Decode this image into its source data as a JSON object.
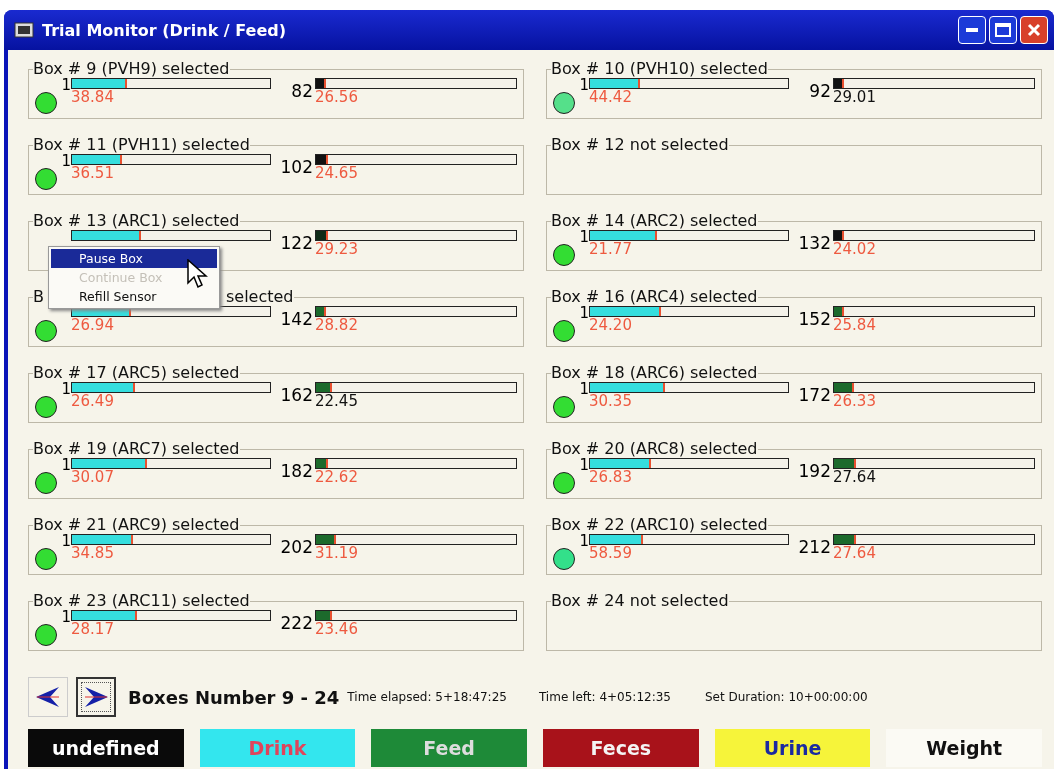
{
  "window": {
    "title": "Trial Monitor (Drink / Feed)"
  },
  "boxes": [
    {
      "title_parts": [
        "Box # 9 (PVH9) selected"
      ],
      "selected": true,
      "color": "#33dd33",
      "left_number": "1",
      "drink": {
        "level": 0.28,
        "reading": "38.84",
        "alert": true
      },
      "feed_number": "82",
      "feed": {
        "level": 0.05,
        "reading": "26.56",
        "alert": true,
        "color": "#111111"
      }
    },
    {
      "title_parts": [
        "Box # 10 (PVH10) selected"
      ],
      "selected": true,
      "color": "#55e08a",
      "left_number": "1",
      "drink": {
        "level": 0.25,
        "reading": "44.42",
        "alert": true
      },
      "feed_number": "92",
      "feed": {
        "level": 0.05,
        "reading": "29.01",
        "alert": false,
        "color": "#111111"
      }
    },
    {
      "title_parts": [
        "Box # 11 (PVH11) selected"
      ],
      "selected": true,
      "color": "#33dd33",
      "left_number": "1",
      "drink": {
        "level": 0.25,
        "reading": "36.51",
        "alert": true
      },
      "feed_number": "102",
      "feed": {
        "level": 0.06,
        "reading": "24.65",
        "alert": true,
        "color": "#111111"
      }
    },
    {
      "title_parts": [
        "Box # 12 not selected"
      ],
      "selected": false
    },
    {
      "title_parts": [
        "Box # 13 (ARC1) selected"
      ],
      "selected": true,
      "drink": {
        "level": 0.35
      },
      "feed_number": "122",
      "feed": {
        "level": 0.06,
        "reading": "29.23",
        "alert": true,
        "color": "#0e2a16"
      }
    },
    {
      "title_parts": [
        "Box # 14 (ARC2) selected"
      ],
      "selected": true,
      "color": "#33dd33",
      "left_number": "1",
      "drink": {
        "level": 0.34,
        "reading": "21.77",
        "alert": true
      },
      "feed_number": "132",
      "feed": {
        "level": 0.05,
        "reading": "24.02",
        "alert": true,
        "color": "#111111"
      }
    },
    {
      "title_parts": [
        "B",
        "selected"
      ],
      "selected": true,
      "color": "#33dd33",
      "drink": {
        "level": 0.3,
        "reading": "26.94",
        "alert": true
      },
      "feed_number": "142",
      "feed": {
        "level": 0.05,
        "reading": "28.82",
        "alert": true,
        "color": "#1c6a2c"
      }
    },
    {
      "title_parts": [
        "Box # 16 (ARC4) selected"
      ],
      "selected": true,
      "color": "#33dd33",
      "left_number": "1",
      "drink": {
        "level": 0.36,
        "reading": "24.20",
        "alert": true
      },
      "feed_number": "152",
      "feed": {
        "level": 0.05,
        "reading": "25.84",
        "alert": true,
        "color": "#1c6a2c"
      }
    },
    {
      "title_parts": [
        "Box # 17 (ARC5) selected"
      ],
      "selected": true,
      "color": "#33dd33",
      "left_number": "1",
      "drink": {
        "level": 0.32,
        "reading": "26.49",
        "alert": true
      },
      "feed_number": "162",
      "feed": {
        "level": 0.08,
        "reading": "22.45",
        "alert": false,
        "color": "#1c6a2c"
      }
    },
    {
      "title_parts": [
        "Box # 18 (ARC6) selected"
      ],
      "selected": true,
      "color": "#33dd33",
      "left_number": "1",
      "drink": {
        "level": 0.38,
        "reading": "30.35",
        "alert": true
      },
      "feed_number": "172",
      "feed": {
        "level": 0.1,
        "reading": "26.33",
        "alert": true,
        "color": "#1c6a2c"
      }
    },
    {
      "title_parts": [
        "Box # 19 (ARC7) selected"
      ],
      "selected": true,
      "color": "#33dd33",
      "left_number": "1",
      "drink": {
        "level": 0.38,
        "reading": "30.07",
        "alert": true
      },
      "feed_number": "182",
      "feed": {
        "level": 0.06,
        "reading": "22.62",
        "alert": true,
        "color": "#1c6a2c"
      }
    },
    {
      "title_parts": [
        "Box # 20 (ARC8) selected"
      ],
      "selected": true,
      "color": "#33dd33",
      "left_number": "1",
      "drink": {
        "level": 0.31,
        "reading": "26.83",
        "alert": true
      },
      "feed_number": "192",
      "feed": {
        "level": 0.11,
        "reading": "27.64",
        "alert": false,
        "color": "#1c6a2c"
      }
    },
    {
      "title_parts": [
        "Box # 21 (ARC9) selected"
      ],
      "selected": true,
      "color": "#33dd33",
      "left_number": "1",
      "drink": {
        "level": 0.31,
        "reading": "34.85",
        "alert": true
      },
      "feed_number": "202",
      "feed": {
        "level": 0.1,
        "reading": "31.19",
        "alert": true,
        "color": "#1c6a2c"
      }
    },
    {
      "title_parts": [
        "Box # 22 (ARC10) selected"
      ],
      "selected": true,
      "color": "#33e08a",
      "left_number": "1",
      "drink": {
        "level": 0.27,
        "reading": "58.59",
        "alert": true
      },
      "feed_number": "212",
      "feed": {
        "level": 0.11,
        "reading": "27.64",
        "alert": true,
        "color": "#1c6a2c"
      }
    },
    {
      "title_parts": [
        "Box # 23 (ARC11) selected"
      ],
      "selected": true,
      "color": "#33dd33",
      "left_number": "1",
      "drink": {
        "level": 0.33,
        "reading": "28.17",
        "alert": true
      },
      "feed_number": "222",
      "feed": {
        "level": 0.08,
        "reading": "23.46",
        "alert": true,
        "color": "#1c6a2c"
      }
    },
    {
      "title_parts": [
        "Box # 24 not selected"
      ],
      "selected": false
    }
  ],
  "context_menu": [
    {
      "label": "Pause Box",
      "selected": true,
      "disabled": false
    },
    {
      "label": "Continue Box",
      "selected": false,
      "disabled": true
    },
    {
      "label": "Refill Sensor",
      "selected": false,
      "disabled": false
    }
  ],
  "nav": {
    "prev_selected": false,
    "next_selected": true,
    "range": "Boxes Number 9 - 24",
    "elapsed": "Time elapsed: 5+18:47:25",
    "left": "Time left: 4+05:12:35",
    "duration": "Set Duration: 10+00:00:00"
  },
  "legend": [
    {
      "label": "undefined",
      "color": "#0a0a0a"
    },
    {
      "label": "Drink",
      "color": "#33e6ee"
    },
    {
      "label": "Feed",
      "color": "#1e8a38"
    },
    {
      "label": "Feces",
      "color": "#a8121a"
    },
    {
      "label": "Urine",
      "color": "#f6f43a"
    },
    {
      "label": "Weight",
      "color": "#fbfaf4"
    }
  ]
}
